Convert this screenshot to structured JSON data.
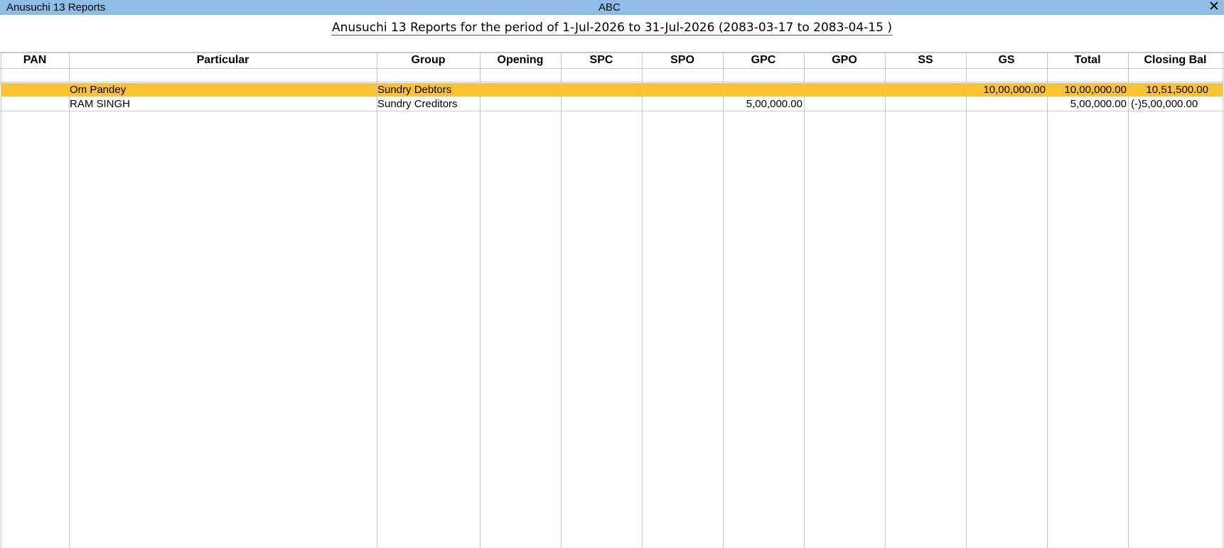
{
  "window": {
    "title": "Anusuchi 13 Reports",
    "company": "ABC",
    "close_symbol": "✕"
  },
  "report": {
    "title": "Anusuchi 13 Reports for the period of 1-Jul-2026 to 31-Jul-2026 (2083-03-17 to 2083-04-15 )"
  },
  "table": {
    "columns": [
      "PAN",
      "Particular",
      "Group",
      "Opening",
      "SPC",
      "SPO",
      "GPC",
      "GPO",
      "SS",
      "GS",
      "Total",
      "Closing Bal"
    ],
    "rows": [
      {
        "pan": "",
        "particular": "Om Pandey",
        "group": "Sundry Debtors",
        "opening": "",
        "spc": "",
        "spo": "",
        "gpc": "",
        "gpo": "",
        "ss": "",
        "gs": "10,00,000.00",
        "total": "10,00,000.00",
        "closing_bal": "10,51,500.00",
        "selected": true
      },
      {
        "pan": "",
        "particular": "RAM SINGH",
        "group": "Sundry Creditors",
        "opening": "",
        "spc": "",
        "spo": "",
        "gpc": "5,00,000.00",
        "gpo": "",
        "ss": "",
        "gs": "",
        "total": "5,00,000.00",
        "closing_bal": "(-)5,00,000.00",
        "selected": false
      }
    ]
  },
  "colors": {
    "titlebar": "#8fbde6",
    "selected_row": "#fbc234",
    "grid": "#c8c8c8"
  }
}
